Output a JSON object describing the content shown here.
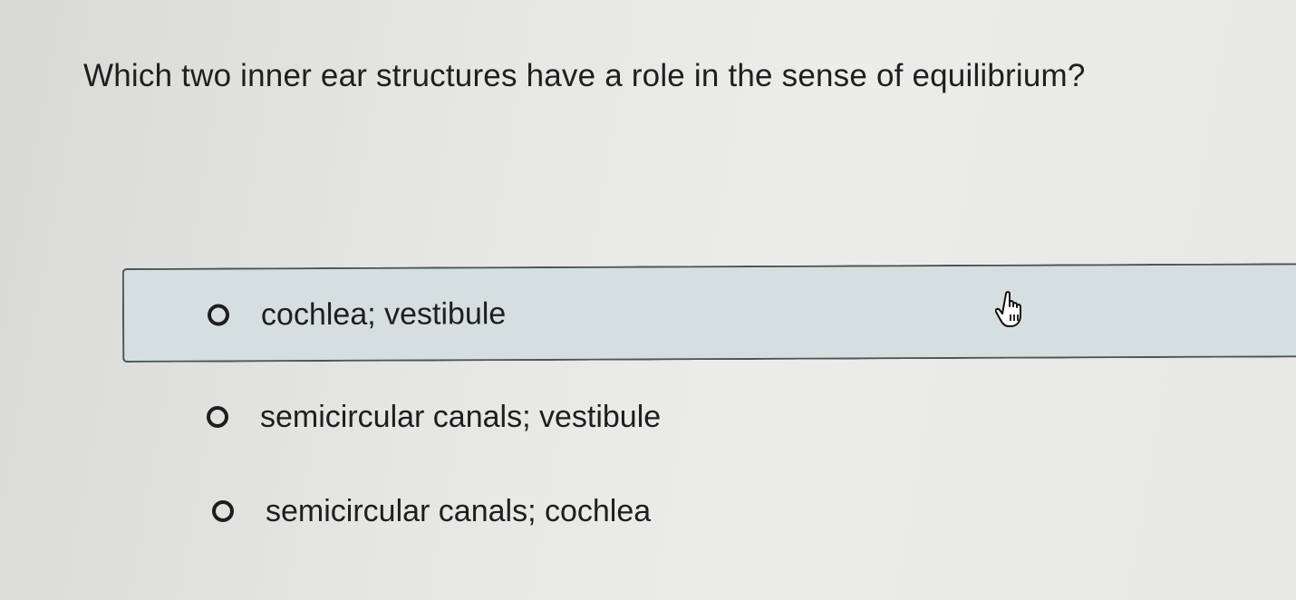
{
  "question": {
    "text": "Which two inner ear structures have a role in the sense of equilibrium?"
  },
  "options": [
    {
      "label": "cochlea; vestibule",
      "state": "hovered"
    },
    {
      "label": "semicircular canals; vestibule",
      "state": "default"
    },
    {
      "label": "semicircular canals; cochlea",
      "state": "default"
    }
  ],
  "cursor": {
    "icon": "hand-pointer-icon"
  },
  "colors": {
    "hover_fill": "#d5dfdf",
    "hover_border": "#4a5557",
    "text": "#1f1f1f",
    "background": "#e6e6e4"
  }
}
